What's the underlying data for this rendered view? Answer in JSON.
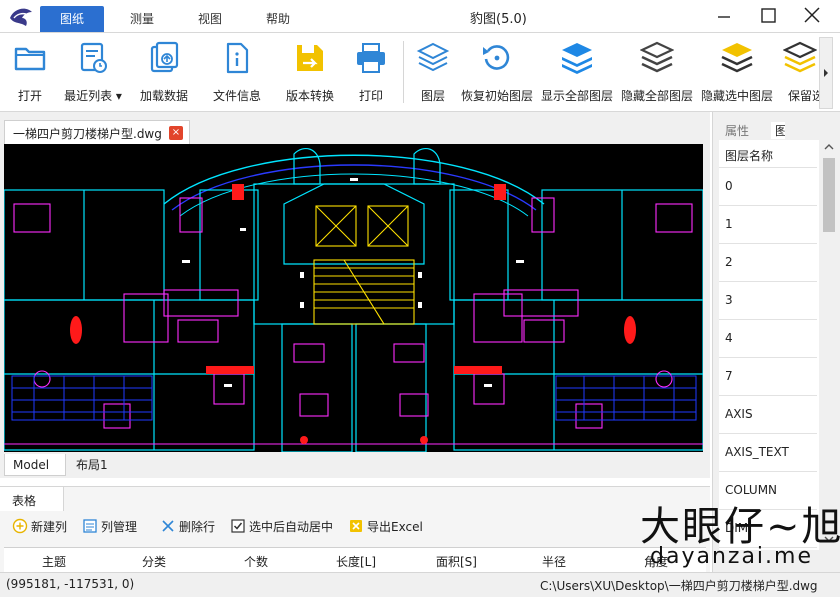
{
  "window": {
    "title": "豹图(5.0)",
    "tabs": [
      "图纸",
      "测量",
      "视图",
      "帮助"
    ],
    "active_tab": "图纸"
  },
  "ribbon": {
    "tools": [
      {
        "label": "打开",
        "icon": "folder-icon"
      },
      {
        "label": "最近列表 ▾",
        "icon": "recent-list-icon"
      },
      {
        "label": "加载数据",
        "icon": "load-data-icon"
      },
      {
        "label": "文件信息",
        "icon": "file-info-icon"
      },
      {
        "label": "版本转换",
        "icon": "version-convert-icon"
      },
      {
        "label": "打印",
        "icon": "printer-icon"
      },
      {
        "label": "图层",
        "icon": "layers-icon"
      },
      {
        "label": "恢复初始图层",
        "icon": "restore-layers-icon"
      },
      {
        "label": "显示全部图层",
        "icon": "show-all-layers-icon"
      },
      {
        "label": "隐藏全部图层",
        "icon": "hide-all-layers-icon"
      },
      {
        "label": "隐藏选中图层",
        "icon": "hide-selected-layers-icon"
      },
      {
        "label": "保留选中",
        "icon": "keep-selected-icon"
      }
    ]
  },
  "document": {
    "tab_title": "一梯四户剪刀楼梯户型.dwg",
    "layout_tabs": [
      "Model",
      "布局1"
    ],
    "active_layout": "Model"
  },
  "properties": {
    "tabs": [
      "属性",
      "图层"
    ],
    "active_tab": "图层",
    "header": "图层名称",
    "layers": [
      "0",
      "1",
      "2",
      "3",
      "4",
      "7",
      "AXIS",
      "AXIS_TEXT",
      "COLUMN",
      "DIM"
    ]
  },
  "table_panel": {
    "title": "表格",
    "buttons": [
      "新建列",
      "列管理",
      "删除行",
      "选中后自动居中",
      "导出Excel"
    ],
    "auto_center_checked": true,
    "columns": [
      "主题",
      "分类",
      "个数",
      "长度[L]",
      "面积[S]",
      "半径",
      "角度"
    ]
  },
  "status": {
    "coordinates": "(995181, -117531, 0)",
    "file_path": "C:\\Users\\XU\\Desktop\\一梯四户剪刀楼梯户型.dwg"
  },
  "watermark": {
    "text": "大眼仔~旭",
    "url": "dayanzai.me"
  },
  "colors": {
    "accent": "#2b6fd0",
    "cad_background": "#000000",
    "icon_blue": "#2f86d6",
    "icon_yellow": "#f2c200"
  }
}
